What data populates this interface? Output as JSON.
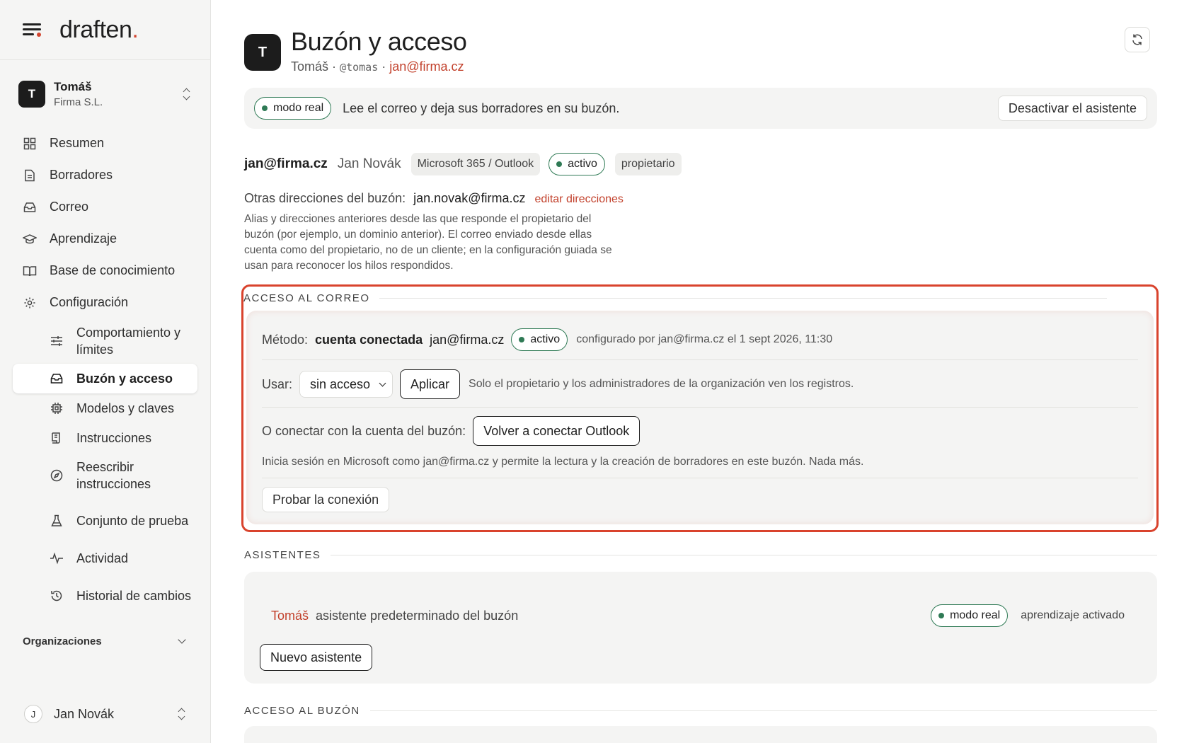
{
  "brand": {
    "logo": "draften",
    "logo_dot": "."
  },
  "account": {
    "initial": "T",
    "name": "Tomáš",
    "org": "Firma S.L."
  },
  "nav": {
    "items": [
      {
        "label": "Resumen",
        "icon": "dashboard-icon"
      },
      {
        "label": "Borradores",
        "icon": "document-icon"
      },
      {
        "label": "Correo",
        "icon": "inbox-icon"
      },
      {
        "label": "Aprendizaje",
        "icon": "graduation-cap-icon"
      },
      {
        "label": "Base de conocimiento",
        "icon": "book-icon"
      },
      {
        "label": "Configuración",
        "icon": "gear-icon"
      }
    ],
    "sub": [
      {
        "label": "Comportamiento y límites",
        "icon": "sliders-icon"
      },
      {
        "label": "Buzón y acceso",
        "icon": "inbox-icon"
      },
      {
        "label": "Modelos y claves",
        "icon": "chip-icon"
      },
      {
        "label": "Instrucciones",
        "icon": "scroll-icon"
      },
      {
        "label": "Reescribir instrucciones",
        "icon": "compass-icon"
      },
      {
        "label": "Conjunto de prueba",
        "icon": "flask-icon"
      },
      {
        "label": "Actividad",
        "icon": "activity-icon"
      },
      {
        "label": "Historial de cambios",
        "icon": "history-icon"
      }
    ],
    "organizations_label": "Organizaciones"
  },
  "user": {
    "initial": "J",
    "name": "Jan Novák"
  },
  "page": {
    "initial": "T",
    "title": "Buzón y acceso",
    "sub_name": "Tomáš",
    "sub_handle": "@tomas",
    "sub_email": "jan@firma.cz",
    "sep": "·"
  },
  "banner": {
    "mode": "modo real",
    "text": "Lee el correo y deja sus borradores en su buzón.",
    "deactivate": "Desactivar el asistente"
  },
  "mailbox": {
    "email": "jan@firma.cz",
    "owner_name": "Jan Novák",
    "provider": "Microsoft 365 / Outlook",
    "status": "activo",
    "role": "propietario",
    "other_label": "Otras direcciones del buzón:",
    "other_addr": "jan.novak@firma.cz",
    "edit_link": "editar direcciones",
    "help": "Alias y direcciones anteriores desde las que responde el propietario del buzón (por ejemplo, un dominio anterior). El correo enviado desde ellas cuenta como del propietario, no de un cliente; en la configuración guiada se usan para reconocer los hilos respondidos."
  },
  "access": {
    "section": "ACCESO AL CORREO",
    "method_label": "Método:",
    "method_value": "cuenta conectada",
    "method_email": "jan@firma.cz",
    "status": "activo",
    "configured": "configurado por jan@firma.cz el 1 sept 2026, 11:30",
    "use_label": "Usar:",
    "use_value": "sin acceso",
    "apply": "Aplicar",
    "use_note": "Solo el propietario y los administradores de la organización ven los registros.",
    "connect_label": "O conectar con la cuenta del buzón:",
    "reconnect": "Volver a conectar Outlook",
    "connect_note": "Inicia sesión en Microsoft como jan@firma.cz y permite la lectura y la creación de borradores en este buzón. Nada más.",
    "test": "Probar la conexión"
  },
  "assistants": {
    "section": "ASISTENTES",
    "name": "Tomáš",
    "desc": "asistente predeterminado del buzón",
    "mode": "modo real",
    "learning": "aprendizaje activado",
    "new": "Nuevo asistente"
  },
  "mailbox_access": {
    "section": "ACCESO AL BUZÓN"
  },
  "colors": {
    "accent": "#c2412c",
    "highlight": "#d9432d",
    "live": "#2f7a55"
  }
}
